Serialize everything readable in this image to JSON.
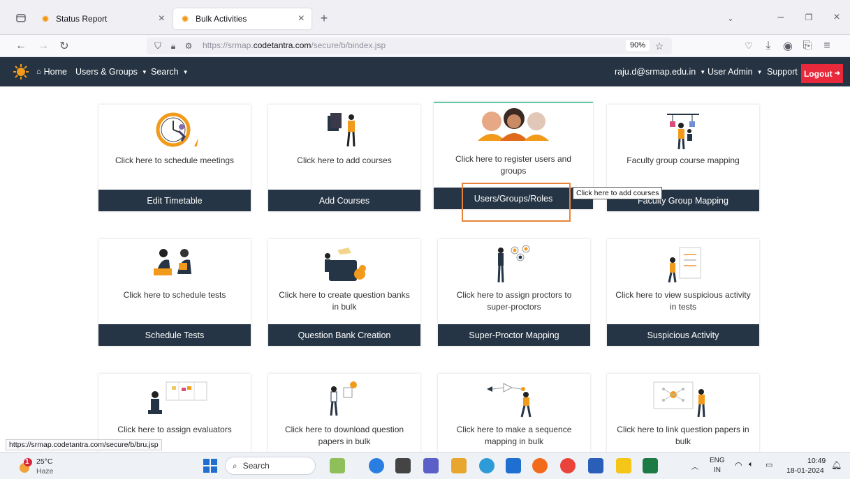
{
  "browser": {
    "tabs": [
      {
        "label": "Status Report",
        "active": false
      },
      {
        "label": "Bulk Activities",
        "active": true
      }
    ],
    "url_prefix": "https://srmap.",
    "url_domain": "codetantra.com",
    "url_path": "/secure/b/bindex.jsp",
    "zoom": "90%",
    "status_link": "https://srmap.codetantra.com/secure/b/bru.jsp"
  },
  "app_header": {
    "home": "Home",
    "users_groups": "Users & Groups",
    "search": "Search",
    "user_email": "raju.d@srmap.edu.in",
    "user_admin": "User Admin",
    "support": "Support",
    "logout": "Logout"
  },
  "cards": [
    {
      "desc": "Click here to schedule meetings",
      "button": "Edit Timetable",
      "icon": "clock-illustration"
    },
    {
      "desc": "Click here to add courses",
      "button": "Add Courses",
      "icon": "course-illustration"
    },
    {
      "desc": "Click here to register users and groups",
      "button": "Users/Groups/Roles",
      "icon": "people-illustration"
    },
    {
      "desc": "Faculty group course mapping",
      "button": "Faculty Group Mapping",
      "icon": "mapping-illustration"
    },
    {
      "desc": "Click here to schedule tests",
      "button": "Schedule Tests",
      "icon": "tests-illustration"
    },
    {
      "desc": "Click here to create question banks in bulk",
      "button": "Question Bank Creation",
      "icon": "questionbank-illustration"
    },
    {
      "desc": "Click here to assign proctors to super-proctors",
      "button": "Super-Proctor Mapping",
      "icon": "proctor-illustration"
    },
    {
      "desc": "Click here to view suspicious activity in tests",
      "button": "Suspicious Activity",
      "icon": "suspicious-illustration"
    },
    {
      "desc": "Click here to assign evaluators",
      "button": "",
      "icon": "evaluator-illustration"
    },
    {
      "desc": "Click here to download question papers in bulk",
      "button": "",
      "icon": "download-illustration"
    },
    {
      "desc": "Click here to make a sequence mapping in bulk",
      "button": "",
      "icon": "sequence-illustration"
    },
    {
      "desc": "Click here to link question papers in bulk",
      "button": "",
      "icon": "link-illustration"
    }
  ],
  "tooltip": "Click here to add courses",
  "taskbar": {
    "weather_temp": "25°C",
    "weather_desc": "Haze",
    "weather_badge": "1",
    "search": "Search",
    "lang_top": "ENG",
    "lang_bottom": "IN",
    "time": "10:49",
    "date": "18-01-2024"
  },
  "colors": {
    "header_bg": "#253342",
    "button_bg": "#263545",
    "logout_bg": "#e8293b",
    "accent_orange": "#f29a1b",
    "callout": "#e8843a"
  }
}
